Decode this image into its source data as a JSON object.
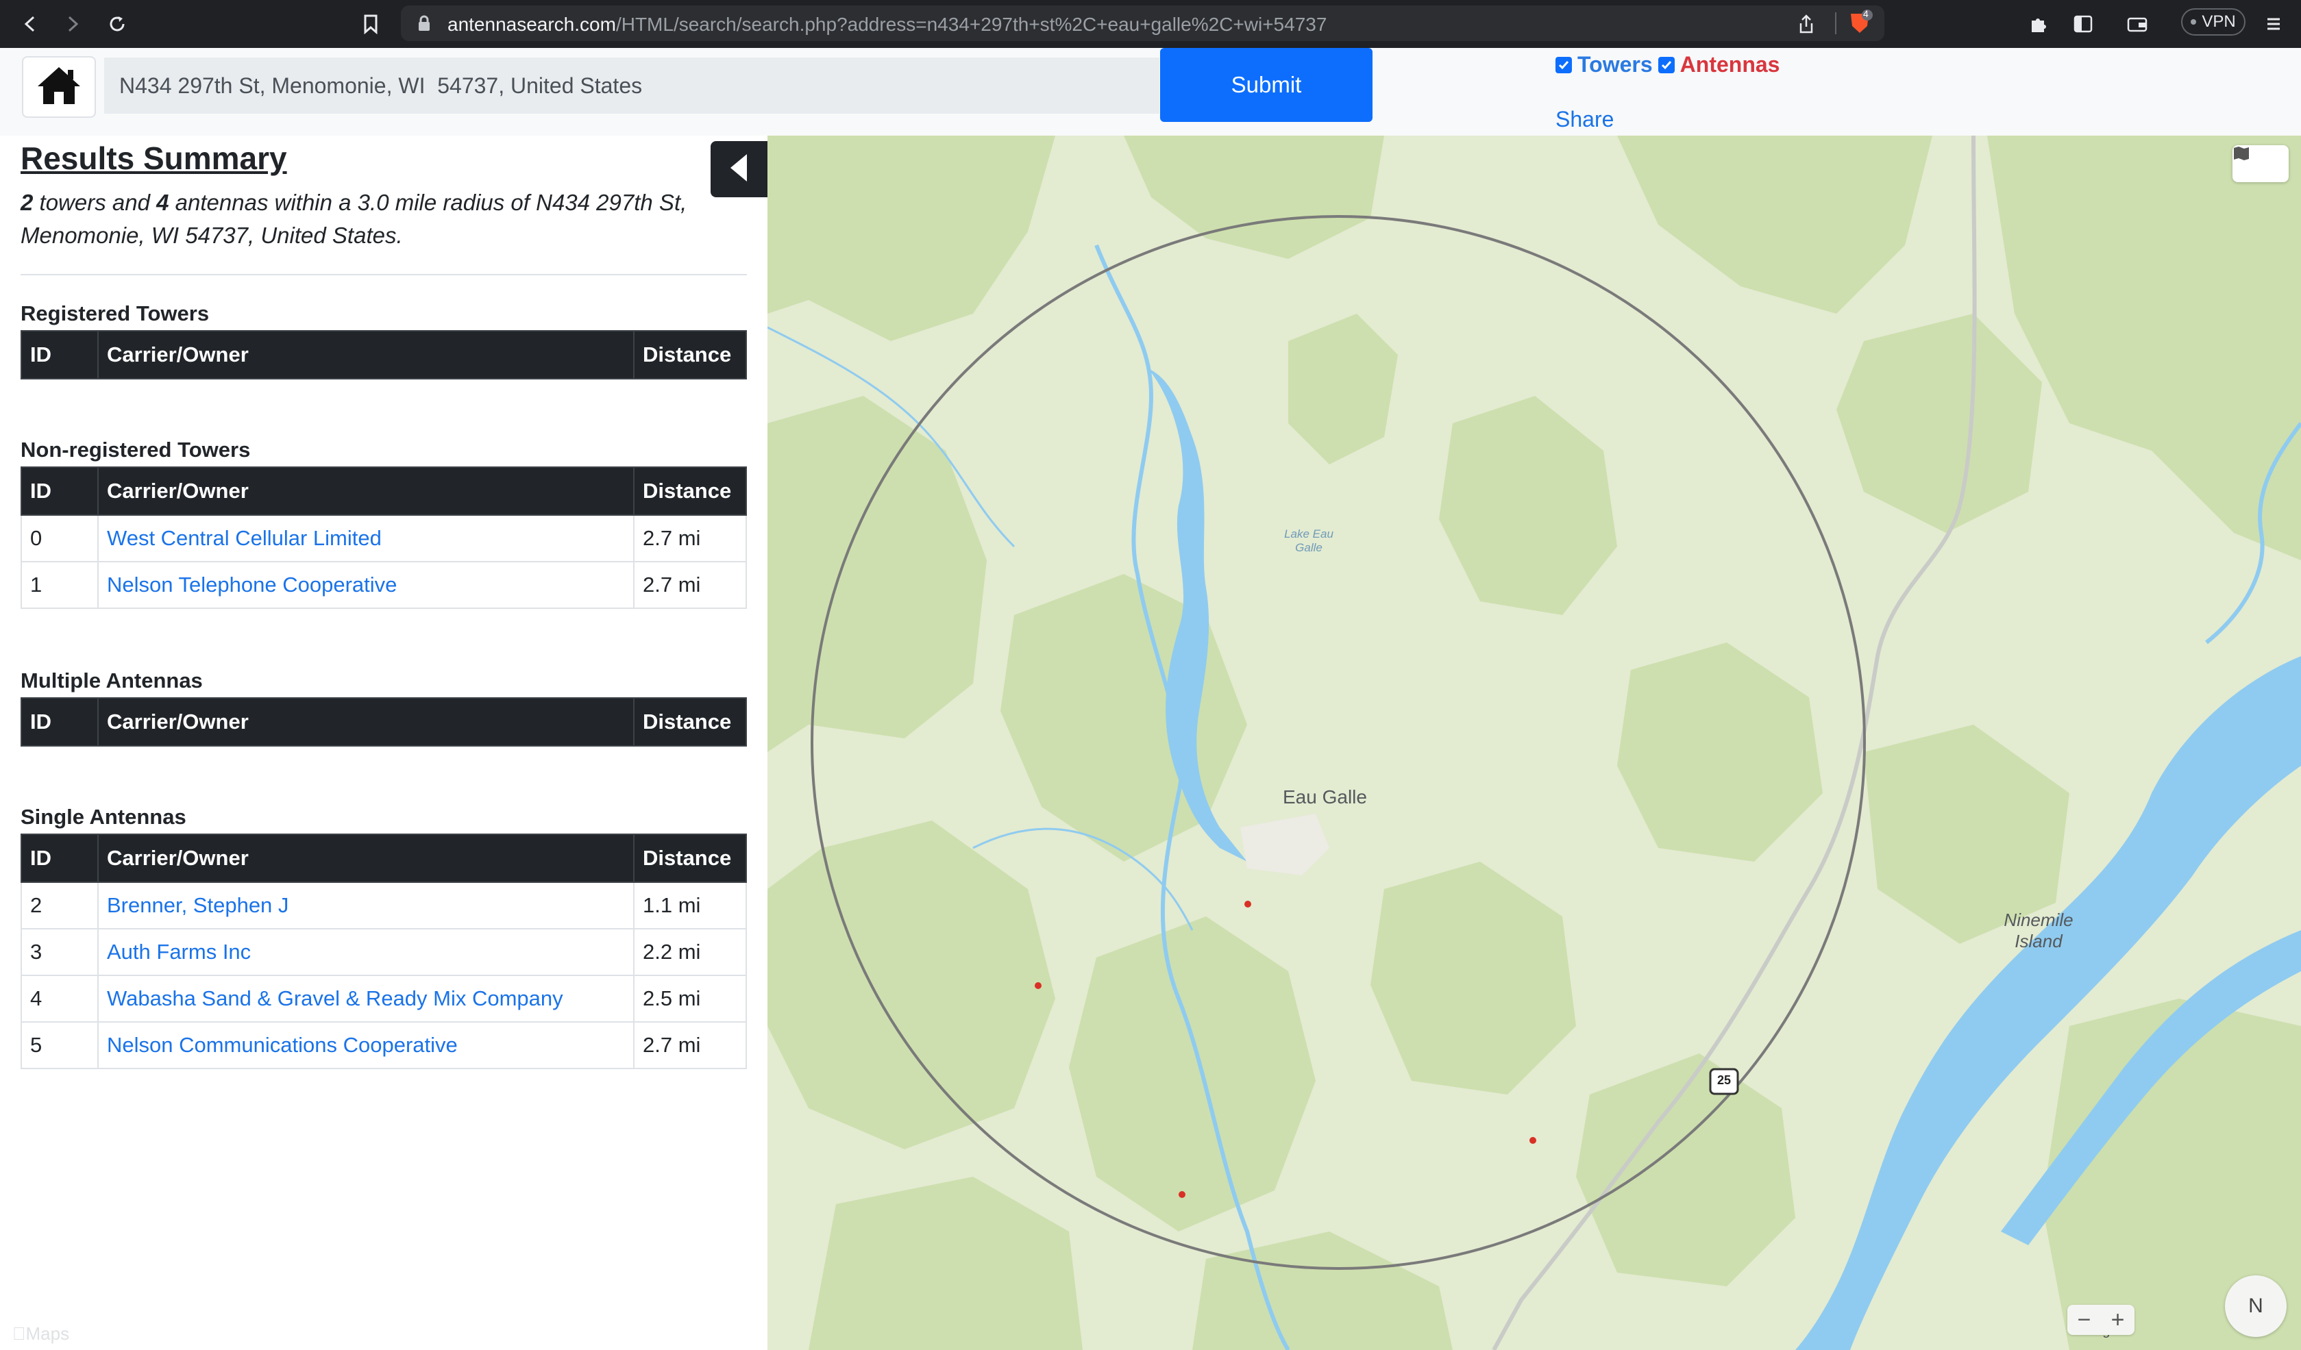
{
  "browser": {
    "url_host": "antennasearch.com",
    "url_path": "/HTML/search/search.php?address=n434+297th+st%2C+eau+galle%2C+wi+54737",
    "vpn_label": "VPN",
    "shield_count": "4"
  },
  "topbar": {
    "address_value": "N434 297th St, Menomonie, WI  54737, United States",
    "submit_label": "Submit",
    "towers_label": "Towers",
    "antennas_label": "Antennas",
    "towers_checked": true,
    "antennas_checked": true,
    "share_label": "Share"
  },
  "summary": {
    "title": "Results Summary",
    "tower_count": "2",
    "text_towers_and": " towers and ",
    "antenna_count": "4",
    "text_rest": " antennas within a 3.0 mile radius of N434 297th St, Menomonie, WI 54737, United States."
  },
  "columns": {
    "id": "ID",
    "carrier": "Carrier/Owner",
    "distance": "Distance"
  },
  "sections": {
    "registered": {
      "title": "Registered Towers",
      "rows": []
    },
    "nonregistered": {
      "title": "Non-registered Towers",
      "rows": [
        {
          "id": "0",
          "carrier": "West Central Cellular Limited",
          "distance": "2.7 mi"
        },
        {
          "id": "1",
          "carrier": "Nelson Telephone Cooperative",
          "distance": "2.7 mi"
        }
      ]
    },
    "multiple": {
      "title": "Multiple Antennas",
      "rows": []
    },
    "single": {
      "title": "Single Antennas",
      "rows": [
        {
          "id": "2",
          "carrier": "Brenner, Stephen J",
          "distance": "1.1 mi"
        },
        {
          "id": "3",
          "carrier": "Auth Farms Inc",
          "distance": "2.2 mi"
        },
        {
          "id": "4",
          "carrier": "Wabasha Sand & Gravel & Ready Mix Company",
          "distance": "2.5 mi"
        },
        {
          "id": "5",
          "carrier": "Nelson Communications Cooperative",
          "distance": "2.7 mi"
        }
      ]
    }
  },
  "map": {
    "labels": {
      "lake": "Lake Eau Galle",
      "town": "Eau Galle",
      "island": "Ninemile Island",
      "route": "25",
      "legal": "Legal",
      "compass": "N",
      "watermark": "Maps"
    },
    "colors": {
      "land": "#e3ebd1",
      "forest": "#c9dcaa",
      "water": "#8fcbf0",
      "marker": "#d93025",
      "circle": "#7a7a7a"
    }
  },
  "icons": {
    "back": "back-arrow-icon",
    "forward": "forward-arrow-icon",
    "reload": "reload-icon",
    "bookmark": "bookmark-icon",
    "lock": "lock-icon",
    "share": "share-icon",
    "brave": "brave-lion-icon",
    "extensions": "puzzle-icon",
    "sidebar": "sidebar-icon",
    "wallet": "wallet-icon",
    "menu": "hamburger-menu-icon",
    "home": "home-icon",
    "collapse": "caret-left-icon",
    "map_type": "map-icon"
  }
}
